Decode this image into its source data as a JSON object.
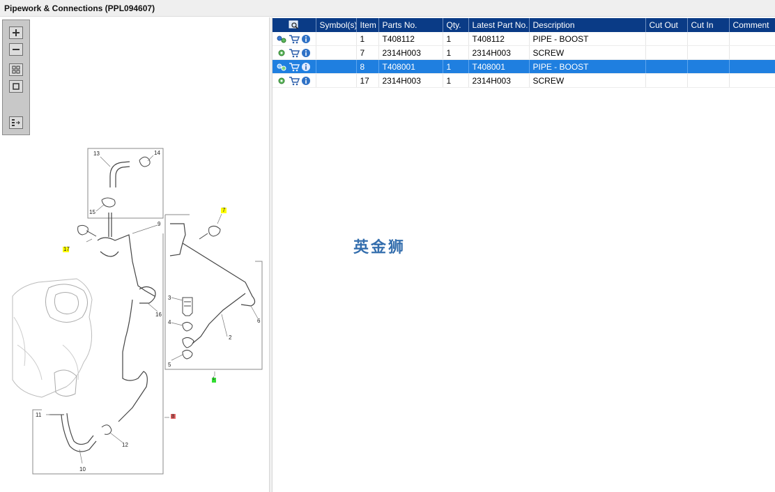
{
  "window": {
    "title": "Pipework & Connections (PPL094607)"
  },
  "toolbar": {
    "buttons": [
      {
        "name": "zoom-in-icon"
      },
      {
        "name": "zoom-out-icon"
      },
      {
        "name": "fit-all-icon"
      },
      {
        "name": "fit-window-icon"
      },
      {
        "name": "panel-toggle-icon"
      }
    ]
  },
  "diagram": {
    "callouts": {
      "c13": "13",
      "c14": "14",
      "c15": "15",
      "c9": "9",
      "c17": "17",
      "c7": "7",
      "c3": "3",
      "c4": "4",
      "c5": "5",
      "c6": "6",
      "c2": "2",
      "c16": "16",
      "c11": "11",
      "c12": "12",
      "c10": "10",
      "c8": "8",
      "c1": "1"
    },
    "highlight_colors": {
      "yellow": "#ffff00",
      "green": "#33dd33",
      "red": "#ee6666"
    }
  },
  "grid": {
    "columns": [
      "",
      "Symbol(s)",
      "Item",
      "Parts No.",
      "Qty.",
      "Latest Part No.",
      "Description",
      "Cut Out",
      "Cut In",
      "Comment"
    ],
    "rows": [
      {
        "item": "1",
        "part_no": "T408112",
        "qty": "1",
        "latest": "T408112",
        "desc": "PIPE - BOOST",
        "symbols": "",
        "cut_out": "",
        "cut_in": "",
        "comment": ""
      },
      {
        "item": "7",
        "part_no": "2314H003",
        "qty": "1",
        "latest": "2314H003",
        "desc": "SCREW",
        "symbols": "",
        "cut_out": "",
        "cut_in": "",
        "comment": ""
      },
      {
        "item": "8",
        "part_no": "T408001",
        "qty": "1",
        "latest": "T408001",
        "desc": "PIPE - BOOST",
        "symbols": "",
        "cut_out": "",
        "cut_in": "",
        "comment": ""
      },
      {
        "item": "17",
        "part_no": "2314H003",
        "qty": "1",
        "latest": "2314H003",
        "desc": "SCREW",
        "symbols": "",
        "cut_out": "",
        "cut_in": "",
        "comment": ""
      }
    ],
    "selected_row": "8",
    "header_color": "#0a3b86",
    "selected_color": "#1f7fe0"
  },
  "watermark": {
    "text": "英金狮"
  }
}
